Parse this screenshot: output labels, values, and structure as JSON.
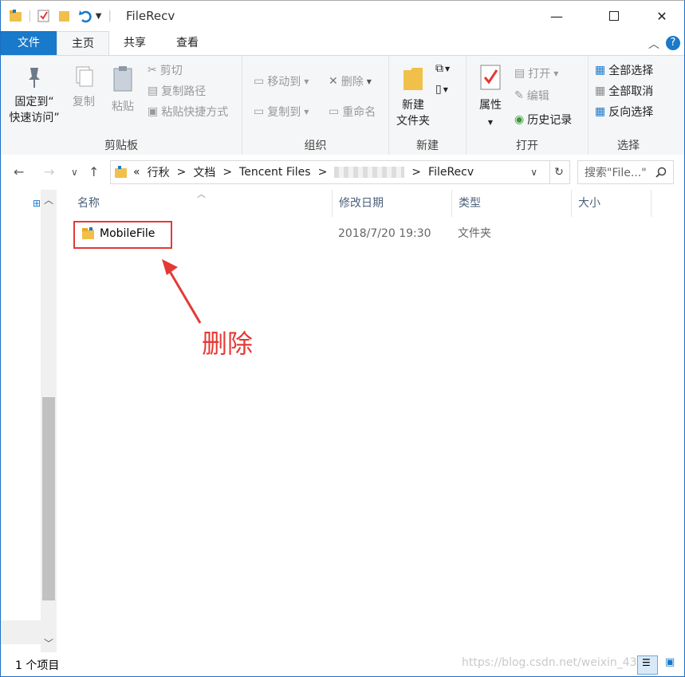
{
  "window": {
    "title": "FileRecv"
  },
  "ribbon": {
    "tabs": [
      "文件",
      "主页",
      "共享",
      "查看"
    ],
    "clipboard": {
      "pin": "固定到“快速访问”",
      "pin_line1": "固定到“",
      "pin_line2": "快速访问”",
      "copy": "复制",
      "paste": "粘贴",
      "cut": "剪切",
      "copy_path": "复制路径",
      "paste_shortcut": "粘贴快捷方式",
      "label": "剪贴板"
    },
    "organize": {
      "move_to": "移动到",
      "delete": "删除",
      "copy_to": "复制到",
      "rename": "重命名",
      "label": "组织"
    },
    "new": {
      "new_folder_line1": "新建",
      "new_folder_line2": "文件夹",
      "label": "新建"
    },
    "open": {
      "properties": "属性",
      "open": "打开",
      "edit": "编辑",
      "history": "历史记录",
      "label": "打开"
    },
    "select": {
      "select_all": "全部选择",
      "select_none": "全部取消",
      "invert": "反向选择",
      "label": "选择"
    }
  },
  "address": {
    "crumbs": [
      "«",
      "行秋",
      ">",
      "文档",
      ">",
      "Tencent Files",
      ">",
      ">",
      "FileRecv"
    ],
    "search_placeholder": "搜索\"File...\""
  },
  "columns": [
    "名称",
    "修改日期",
    "类型",
    "大小"
  ],
  "files": [
    {
      "name": "MobileFile",
      "modified": "2018/7/20 19:30",
      "type": "文件夹",
      "size": ""
    }
  ],
  "status": {
    "count": "1 个项目"
  },
  "annotation": {
    "text": "删除"
  },
  "watermark": "https://blog.csdn.net/weixin_43",
  "colors": {
    "accent": "#1979ca",
    "annotation": "#e53935",
    "folder": "#f0c04a"
  }
}
